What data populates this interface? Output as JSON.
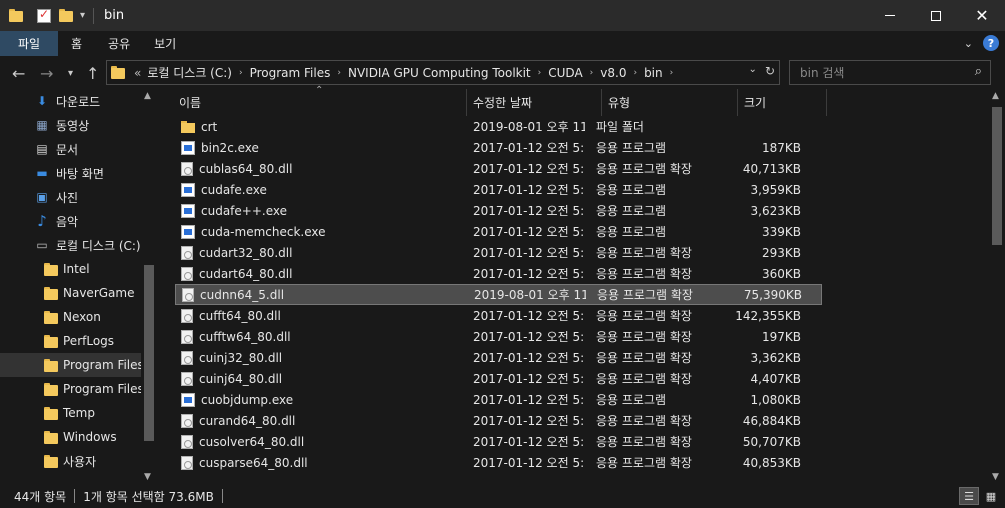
{
  "window": {
    "title": "bin"
  },
  "ribbon": {
    "tabs": [
      "파일",
      "홈",
      "공유",
      "보기"
    ]
  },
  "address": {
    "overflow": "«",
    "crumbs": [
      "로컬 디스크 (C:)",
      "Program Files",
      "NVIDIA GPU Computing Toolkit",
      "CUDA",
      "v8.0",
      "bin"
    ]
  },
  "search": {
    "placeholder": "bin 검색"
  },
  "nav": {
    "items": [
      {
        "label": "다운로드",
        "icon": "download-icon"
      },
      {
        "label": "동영상",
        "icon": "video-icon"
      },
      {
        "label": "문서",
        "icon": "document-icon"
      },
      {
        "label": "바탕 화면",
        "icon": "desktop-icon"
      },
      {
        "label": "사진",
        "icon": "picture-icon"
      },
      {
        "label": "음악",
        "icon": "music-icon"
      },
      {
        "label": "로컬 디스크 (C:)",
        "icon": "drive-icon"
      },
      {
        "label": "Intel",
        "icon": "folder-icon"
      },
      {
        "label": "NaverGame",
        "icon": "folder-icon"
      },
      {
        "label": "Nexon",
        "icon": "folder-icon"
      },
      {
        "label": "PerfLogs",
        "icon": "folder-icon"
      },
      {
        "label": "Program Files",
        "icon": "folder-icon"
      },
      {
        "label": "Program Files",
        "icon": "folder-icon"
      },
      {
        "label": "Temp",
        "icon": "folder-icon"
      },
      {
        "label": "Windows",
        "icon": "folder-icon"
      },
      {
        "label": "사용자",
        "icon": "folder-icon"
      }
    ]
  },
  "columns": [
    "이름",
    "수정한 날짜",
    "유형",
    "크기"
  ],
  "files": [
    {
      "name": "crt",
      "date": "2019-08-01 오후 11...",
      "type": "파일 폴더",
      "size": "",
      "kind": "folder"
    },
    {
      "name": "bin2c.exe",
      "date": "2017-01-12 오전 5:...",
      "type": "응용 프로그램",
      "size": "187KB",
      "kind": "exe"
    },
    {
      "name": "cublas64_80.dll",
      "date": "2017-01-12 오전 5:...",
      "type": "응용 프로그램 확장",
      "size": "40,713KB",
      "kind": "dll"
    },
    {
      "name": "cudafe.exe",
      "date": "2017-01-12 오전 5:...",
      "type": "응용 프로그램",
      "size": "3,959KB",
      "kind": "exe"
    },
    {
      "name": "cudafe++.exe",
      "date": "2017-01-12 오전 5:...",
      "type": "응용 프로그램",
      "size": "3,623KB",
      "kind": "exe"
    },
    {
      "name": "cuda-memcheck.exe",
      "date": "2017-01-12 오전 5:...",
      "type": "응용 프로그램",
      "size": "339KB",
      "kind": "exe"
    },
    {
      "name": "cudart32_80.dll",
      "date": "2017-01-12 오전 5:...",
      "type": "응용 프로그램 확장",
      "size": "293KB",
      "kind": "dll"
    },
    {
      "name": "cudart64_80.dll",
      "date": "2017-01-12 오전 5:...",
      "type": "응용 프로그램 확장",
      "size": "360KB",
      "kind": "dll"
    },
    {
      "name": "cudnn64_5.dll",
      "date": "2019-08-01 오후 11...",
      "type": "응용 프로그램 확장",
      "size": "75,390KB",
      "kind": "dll"
    },
    {
      "name": "cufft64_80.dll",
      "date": "2017-01-12 오전 5:...",
      "type": "응용 프로그램 확장",
      "size": "142,355KB",
      "kind": "dll"
    },
    {
      "name": "cufftw64_80.dll",
      "date": "2017-01-12 오전 5:...",
      "type": "응용 프로그램 확장",
      "size": "197KB",
      "kind": "dll"
    },
    {
      "name": "cuinj32_80.dll",
      "date": "2017-01-12 오전 5:...",
      "type": "응용 프로그램 확장",
      "size": "3,362KB",
      "kind": "dll"
    },
    {
      "name": "cuinj64_80.dll",
      "date": "2017-01-12 오전 5:...",
      "type": "응용 프로그램 확장",
      "size": "4,407KB",
      "kind": "dll"
    },
    {
      "name": "cuobjdump.exe",
      "date": "2017-01-12 오전 5:...",
      "type": "응용 프로그램",
      "size": "1,080KB",
      "kind": "exe"
    },
    {
      "name": "curand64_80.dll",
      "date": "2017-01-12 오전 5:...",
      "type": "응용 프로그램 확장",
      "size": "46,884KB",
      "kind": "dll"
    },
    {
      "name": "cusolver64_80.dll",
      "date": "2017-01-12 오전 5:...",
      "type": "응용 프로그램 확장",
      "size": "50,707KB",
      "kind": "dll"
    },
    {
      "name": "cusparse64_80.dll",
      "date": "2017-01-12 오전 5:...",
      "type": "응용 프로그램 확장",
      "size": "40,853KB",
      "kind": "dll"
    }
  ],
  "selected_index": 8,
  "status": {
    "count": "44개 항목",
    "selection": "1개 항목 선택함 73.6MB"
  },
  "colors": {
    "accent": "#2f4a63",
    "background": "#191919",
    "selection": "#4d4d4d"
  }
}
